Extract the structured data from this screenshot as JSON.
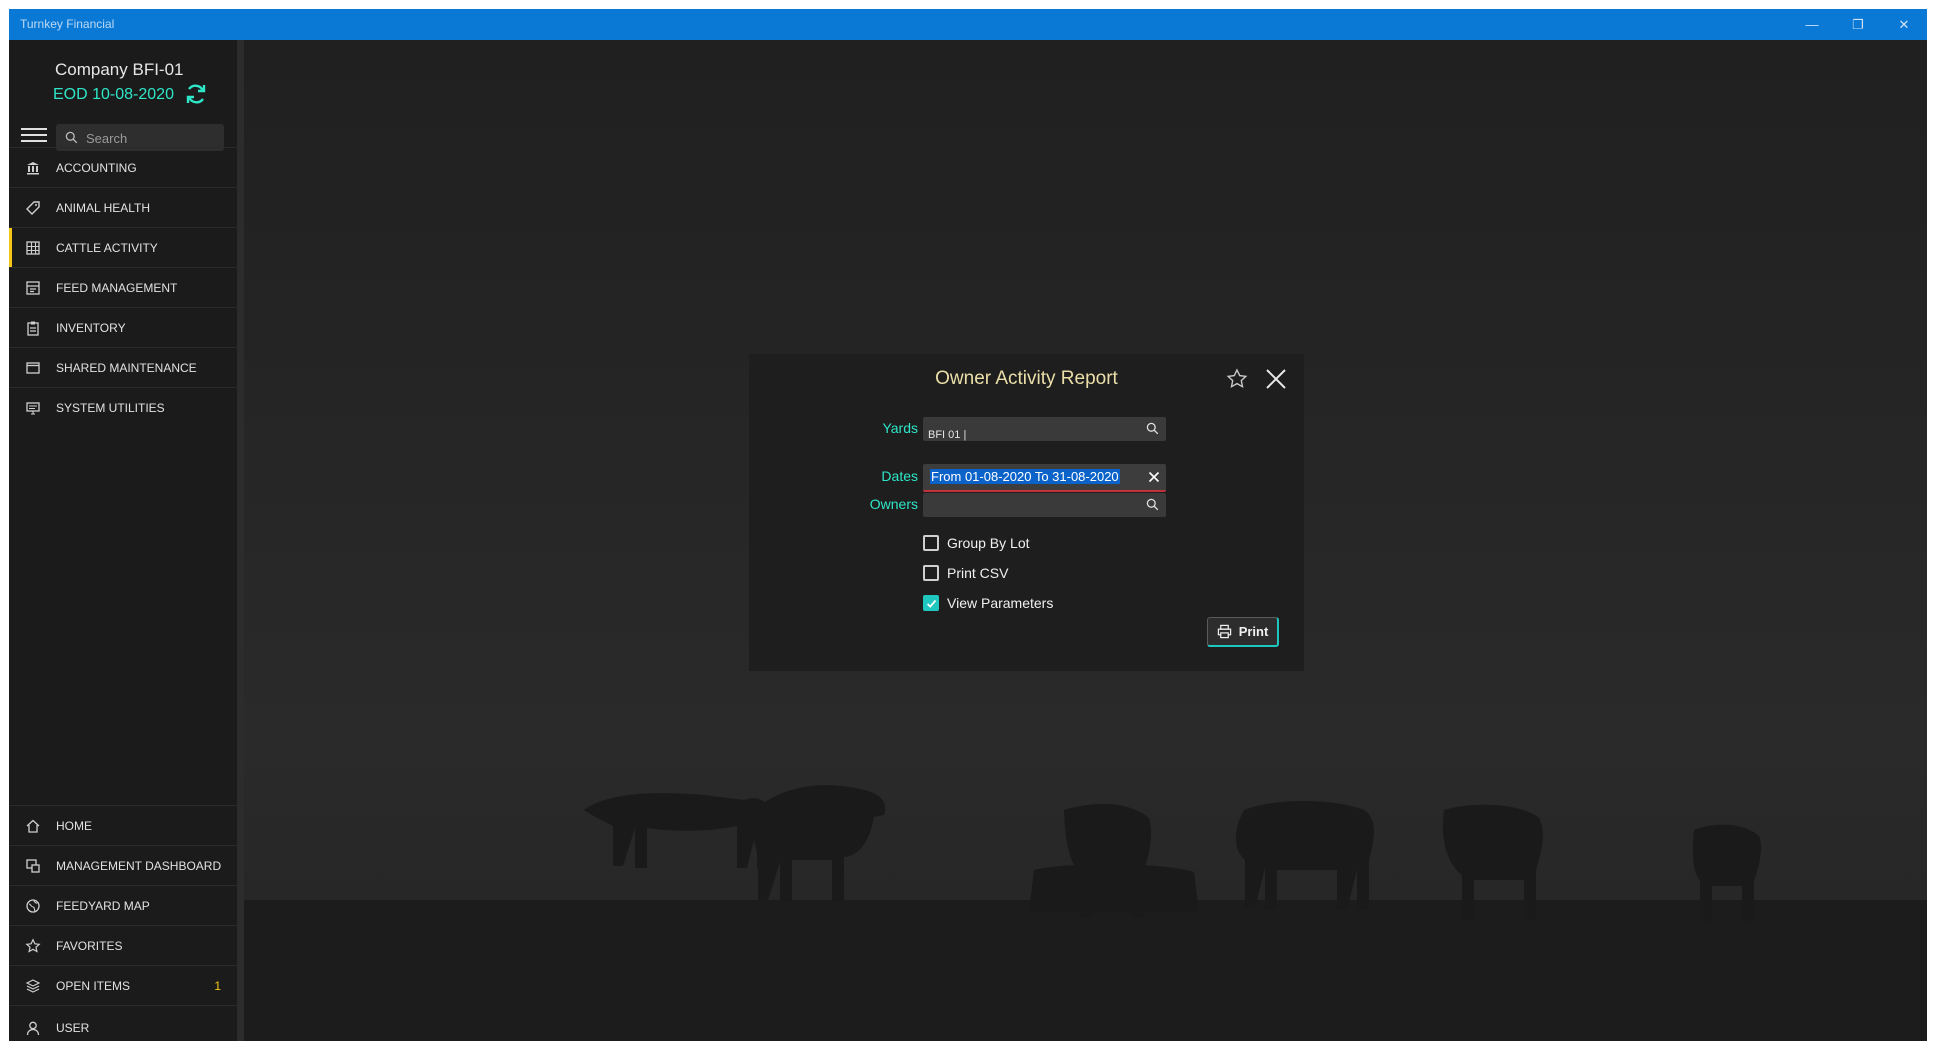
{
  "window": {
    "title": "Turnkey Financial",
    "minimize_glyph": "—",
    "restore_glyph": "❐",
    "close_glyph": "✕"
  },
  "sidebar": {
    "company": "Company BFI-01",
    "eod": "EOD 10-08-2020",
    "search_placeholder": "Search",
    "modules": [
      {
        "label": "ACCOUNTING",
        "icon": "bank-icon"
      },
      {
        "label": "ANIMAL HEALTH",
        "icon": "tag-icon"
      },
      {
        "label": "CATTLE ACTIVITY",
        "icon": "grid-icon",
        "active": true
      },
      {
        "label": "FEED MANAGEMENT",
        "icon": "feed-icon"
      },
      {
        "label": "INVENTORY",
        "icon": "clipboard-icon"
      },
      {
        "label": "SHARED MAINTENANCE",
        "icon": "window-icon"
      },
      {
        "label": "SYSTEM UTILITIES",
        "icon": "monitor-icon"
      }
    ],
    "bottom": [
      {
        "label": "HOME",
        "icon": "home-icon"
      },
      {
        "label": "MANAGEMENT DASHBOARD",
        "icon": "dashboard-icon"
      },
      {
        "label": "FEEDYARD MAP",
        "icon": "globe-icon"
      },
      {
        "label": "FAVORITES",
        "icon": "star-icon"
      },
      {
        "label": "OPEN ITEMS",
        "icon": "layers-icon",
        "badge": "1"
      },
      {
        "label": "USER",
        "icon": "user-icon"
      }
    ]
  },
  "dialog": {
    "title": "Owner Activity Report",
    "yards_label": "Yards",
    "yards_value": "BFI 01 |",
    "dates_label": "Dates",
    "dates_value": "From 01-08-2020 To 31-08-2020",
    "owners_label": "Owners",
    "options": [
      {
        "label": "Group By Lot",
        "checked": false
      },
      {
        "label": "Print CSV",
        "checked": false
      },
      {
        "label": "View Parameters",
        "checked": true
      }
    ],
    "print_label": "Print"
  },
  "colors": {
    "accent": "#2ee6c8",
    "titlebar": "#0a79d6",
    "active_marker": "#f5c518",
    "error_underline": "#c2303a"
  }
}
